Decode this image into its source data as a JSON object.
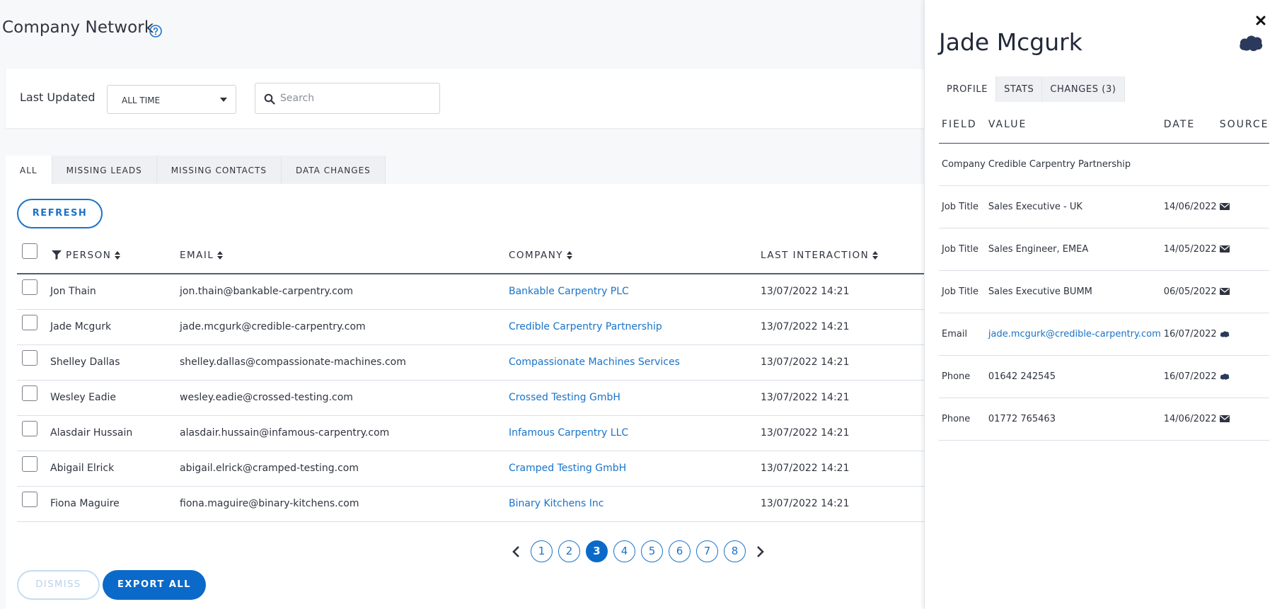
{
  "header": {
    "title": "Company Network"
  },
  "filters": {
    "last_updated_label": "Last Updated",
    "last_updated_value": "ALL TIME",
    "search_placeholder": "Search"
  },
  "tabs": [
    {
      "label": "ALL",
      "active": true
    },
    {
      "label": "MISSING LEADS"
    },
    {
      "label": "MISSING CONTACTS"
    },
    {
      "label": "DATA CHANGES"
    }
  ],
  "refresh_label": "REFRESH",
  "table": {
    "columns": {
      "person": "PERSON",
      "email": "EMAIL",
      "company": "COMPANY",
      "last_interaction": "LAST INTERACTION"
    },
    "rows": [
      {
        "person": "Jon Thain",
        "email": "jon.thain@bankable-carpentry.com",
        "company": "Bankable Carpentry PLC",
        "last_interaction": "13/07/2022 14:21"
      },
      {
        "person": "Jade Mcgurk",
        "email": "jade.mcgurk@credible-carpentry.com",
        "company": "Credible Carpentry Partnership",
        "last_interaction": "13/07/2022 14:21"
      },
      {
        "person": "Shelley Dallas",
        "email": "shelley.dallas@compassionate-machines.com",
        "company": "Compassionate Machines Services",
        "last_interaction": "13/07/2022 14:21"
      },
      {
        "person": "Wesley Eadie",
        "email": "wesley.eadie@crossed-testing.com",
        "company": "Crossed Testing GmbH",
        "last_interaction": "13/07/2022 14:21"
      },
      {
        "person": "Alasdair Hussain",
        "email": "alasdair.hussain@infamous-carpentry.com",
        "company": "Infamous Carpentry LLC",
        "last_interaction": "13/07/2022 14:21"
      },
      {
        "person": "Abigail Elrick",
        "email": "abigail.elrick@cramped-testing.com",
        "company": "Cramped Testing GmbH",
        "last_interaction": "13/07/2022 14:21"
      },
      {
        "person": "Fiona Maguire",
        "email": "fiona.maguire@binary-kitchens.com",
        "company": "Binary Kitchens Inc",
        "last_interaction": "13/07/2022 14:21"
      }
    ]
  },
  "pagination": {
    "pages": [
      "1",
      "2",
      "3",
      "4",
      "5",
      "6",
      "7",
      "8"
    ],
    "current": "3"
  },
  "actions": {
    "dismiss_label": "DISMISS",
    "export_label": "EXPORT ALL"
  },
  "panel": {
    "title": "Jade Mcgurk",
    "tabs": [
      {
        "label": "PROFILE",
        "active": true
      },
      {
        "label": "STATS"
      },
      {
        "label": "CHANGES (3)"
      }
    ],
    "columns": {
      "field": "FIELD",
      "value": "VALUE",
      "date": "DATE",
      "source": "SOURCE"
    },
    "rows": [
      {
        "field": "Company",
        "value": "Credible Carpentry Partnership",
        "date": "",
        "source": ""
      },
      {
        "field": "Job Title",
        "value": "Sales Executive - UK",
        "date": "14/06/2022",
        "source": "mail-icon"
      },
      {
        "field": "Job Title",
        "value": "Sales Engineer, EMEA",
        "date": "14/05/2022",
        "source": "mail-icon"
      },
      {
        "field": "Job Title",
        "value": "Sales Executive BUMM",
        "date": "06/05/2022",
        "source": "mail-icon"
      },
      {
        "field": "Email",
        "value": "jade.mcgurk@credible-carpentry.com",
        "date": "16/07/2022",
        "source": "cloud-icon",
        "link": true
      },
      {
        "field": "Phone",
        "value": "01642 242545",
        "date": "16/07/2022",
        "source": "cloud-icon"
      },
      {
        "field": "Phone",
        "value": "01772 765463",
        "date": "14/06/2022",
        "source": "mail-icon"
      }
    ]
  },
  "colors": {
    "accent": "#0b6ac9",
    "link": "#1a73c8",
    "text": "#2f3440",
    "navy": "#22293a"
  }
}
